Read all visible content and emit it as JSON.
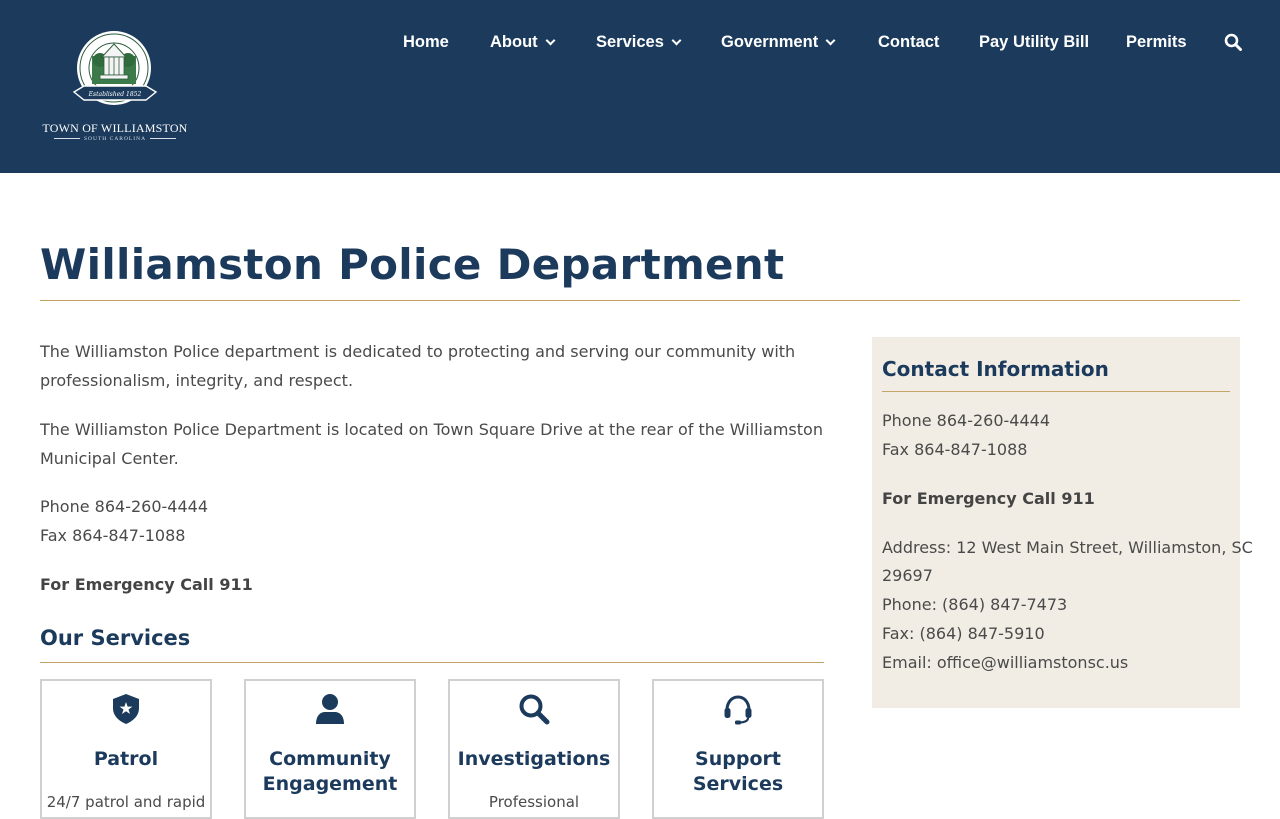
{
  "header": {
    "logo": {
      "seal_text": "Town of Williamston, South Carolina",
      "established": "Established 1852",
      "name": "TOWN OF WILLIAMSTON",
      "subtitle": "SOUTH CAROLINA"
    },
    "nav": [
      {
        "label": "Home",
        "dropdown": false
      },
      {
        "label": "About",
        "dropdown": true
      },
      {
        "label": "Services",
        "dropdown": true
      },
      {
        "label": "Government",
        "dropdown": true
      },
      {
        "label": "Contact",
        "dropdown": false
      },
      {
        "label": "Pay Utility Bill",
        "dropdown": false
      },
      {
        "label": "Permits",
        "dropdown": false
      }
    ],
    "search_icon": "search-icon"
  },
  "page": {
    "title": "Williamston Police Department",
    "intro": "The Williamston Police department is dedicated to protecting and serving our community with professionalism, integrity, and respect.",
    "location": "The Williamston Police Department is located on Town Square Drive at the rear of the Williamston Municipal Center.",
    "phone": "Phone 864-260-4444",
    "fax": "Fax 864-847-1088",
    "emergency": "For Emergency Call 911"
  },
  "services": {
    "title": "Our Services",
    "cards": [
      {
        "icon": "shield-icon",
        "title": "Patrol",
        "desc": "24/7 patrol and rapid"
      },
      {
        "icon": "user-icon",
        "title": "Community Engagement",
        "desc": ""
      },
      {
        "icon": "search-icon",
        "title": "Investigations",
        "desc": "Professional"
      },
      {
        "icon": "headset-icon",
        "title": "Support Services",
        "desc": ""
      }
    ]
  },
  "sidebar": {
    "title": "Contact Information",
    "phone": "Phone 864-260-4444",
    "fax": "Fax 864-847-1088",
    "emergency": "For Emergency Call 911",
    "address_line1": "Address: 12 West Main Street, Williamston, SC",
    "address_line2": "29697",
    "office_phone": "Phone: (864) 847-7473",
    "office_fax": "Fax: (864) 847-5910",
    "email": "Email: office@williamstonsc.us"
  },
  "colors": {
    "header_bg": "#1b3a5c",
    "accent_rule": "#c4a468",
    "sidebar_bg": "#f1ede4",
    "heading": "#1b3a5c"
  }
}
